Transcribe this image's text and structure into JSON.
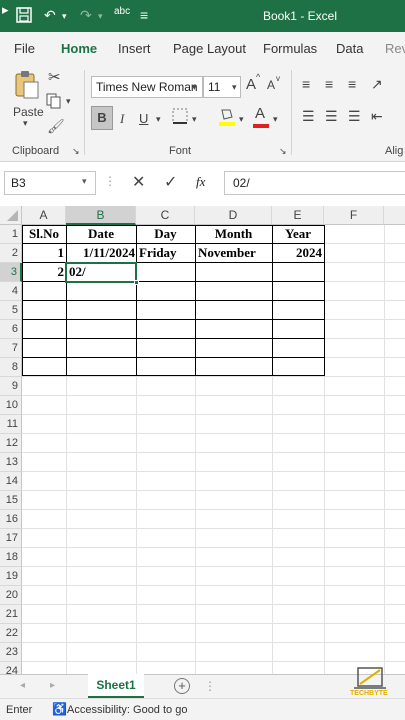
{
  "titlebar": {
    "title": "Book1  -  Excel",
    "spelling": "abc"
  },
  "tabs": [
    "File",
    "Home",
    "Insert",
    "Page Layout",
    "Formulas",
    "Data",
    "Rev"
  ],
  "ribbon": {
    "paste_label": "Paste",
    "font_name": "Times New Roman",
    "font_size": "11",
    "bold": "B",
    "italic": "I",
    "underline": "U",
    "grow_font": "A",
    "shrink_font": "A",
    "font_color": "A",
    "clipboard_label": "Clipboard",
    "font_label": "Font",
    "alignment_label": "Alig"
  },
  "formula_bar": {
    "name_box": "B3",
    "fx": "fx",
    "content": "02/"
  },
  "columns": [
    "A",
    "B",
    "C",
    "D",
    "E",
    "F"
  ],
  "rows": [
    "1",
    "2",
    "3",
    "4",
    "5",
    "6",
    "7",
    "8",
    "9",
    "10",
    "11",
    "12",
    "13",
    "14",
    "15",
    "16",
    "17",
    "18",
    "19",
    "20",
    "21",
    "22",
    "23",
    "24"
  ],
  "table": {
    "headers": [
      "Sl.No",
      "Date",
      "Day",
      "Month",
      "Year"
    ],
    "row1": [
      "1",
      "1/11/2024",
      "Friday",
      "November",
      "2024"
    ],
    "row2_a": "2",
    "row2_b": "02/"
  },
  "sheet": {
    "tab": "Sheet1",
    "add": "+"
  },
  "status": {
    "mode": "Enter",
    "accessibility": "Accessibility: Good to go"
  },
  "watermark": {
    "text": "TECHBYTE"
  },
  "colors": {
    "accent": "#1e7145"
  }
}
